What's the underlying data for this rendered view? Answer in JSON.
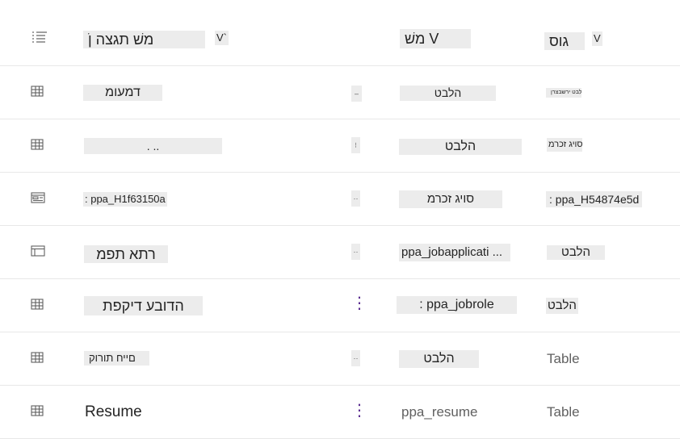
{
  "header": {
    "display_name_label": "משׁ תגצה ןֹ",
    "display_name_sort": "V`",
    "name_label": "משׁ V",
    "type_label": "גוס",
    "type_sort": "V"
  },
  "rows": [
    {
      "icon": "table-icon",
      "display_name": "דמעומ",
      "more": "–",
      "name": "הלבט",
      "type": "ילבט ירשבצרן"
    },
    {
      "icon": "table-icon",
      "display_name": ". ..",
      "more": "⁝",
      "name": "הלבט",
      "type": "סויג זכרמ"
    },
    {
      "icon": "form-icon",
      "display_name": ": ppa_H1f63150a",
      "more": "··",
      "name": "סויג זכרמ",
      "type": ": ppa_H54874e5d"
    },
    {
      "icon": "view-icon",
      "display_name": "רתא תפמ",
      "more": "··",
      "name": "ppa_jobapplicati ...",
      "type": "הלבט"
    },
    {
      "icon": "table-icon",
      "display_name": "הדובע דיקפת",
      "more": "⋮",
      "name": ": ppa_jobrole",
      "type": "הלבט"
    },
    {
      "icon": "table-icon",
      "display_name": "םייח תורוק",
      "more": "··",
      "name": "הלבט",
      "type": "Table"
    },
    {
      "icon": "table-icon",
      "display_name": "Resume",
      "more": "⋮",
      "name": "ppa_resume",
      "type": "Table"
    }
  ],
  "colors": {
    "accent": "#5c2e91",
    "divider": "#e8e8e8",
    "placeholder": "#ececec"
  }
}
